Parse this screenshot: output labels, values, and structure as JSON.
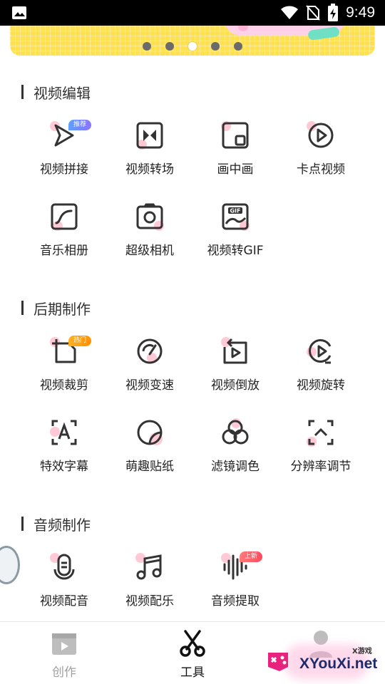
{
  "status_bar": {
    "time": "9:49",
    "icons": [
      "gallery-icon",
      "wifi-icon",
      "no-sim-icon",
      "battery-charging-icon"
    ]
  },
  "banner": {
    "pager_count": 5,
    "active_index": 2
  },
  "sections": {
    "video_edit": {
      "title": "视频编辑",
      "items": [
        {
          "label": "视频拼接",
          "icon": "play-arrow-icon",
          "badge": "推荐"
        },
        {
          "label": "视频转场",
          "icon": "transition-icon"
        },
        {
          "label": "画中画",
          "icon": "picture-in-picture-icon"
        },
        {
          "label": "卡点视频",
          "icon": "play-circle-icon"
        },
        {
          "label": "音乐相册",
          "icon": "music-album-icon"
        },
        {
          "label": "超级相机",
          "icon": "camera-icon"
        },
        {
          "label": "视频转GIF",
          "icon": "gif-icon"
        }
      ]
    },
    "post_production": {
      "title": "后期制作",
      "items": [
        {
          "label": "视频裁剪",
          "icon": "crop-icon",
          "badge": "热门"
        },
        {
          "label": "视频变速",
          "icon": "speedometer-icon"
        },
        {
          "label": "视频倒放",
          "icon": "reverse-play-icon"
        },
        {
          "label": "视频旋转",
          "icon": "rotate-play-icon"
        },
        {
          "label": "特效字幕",
          "icon": "subtitle-icon"
        },
        {
          "label": "萌趣贴纸",
          "icon": "sticker-icon"
        },
        {
          "label": "滤镜调色",
          "icon": "filter-icon"
        },
        {
          "label": "分辨率调节",
          "icon": "resolution-icon"
        }
      ]
    },
    "audio": {
      "title": "音频制作",
      "items": [
        {
          "label": "视频配音",
          "icon": "microphone-icon"
        },
        {
          "label": "视频配乐",
          "icon": "music-note-icon"
        },
        {
          "label": "音频提取",
          "icon": "waveform-icon",
          "badge": "上新"
        }
      ]
    }
  },
  "bottom_nav": {
    "items": [
      {
        "label": "创作",
        "icon": "film-play-icon",
        "active": false
      },
      {
        "label": "工具",
        "icon": "scissors-icon",
        "active": true
      },
      {
        "label": "",
        "icon": "user-icon",
        "active": false
      }
    ]
  },
  "watermark": {
    "text": "XYouXi.net",
    "small": "X游戏"
  },
  "colors": {
    "banner_yellow": "#ffe052",
    "pink_accent": "#ffc9d6",
    "icon_dark": "#333333"
  }
}
